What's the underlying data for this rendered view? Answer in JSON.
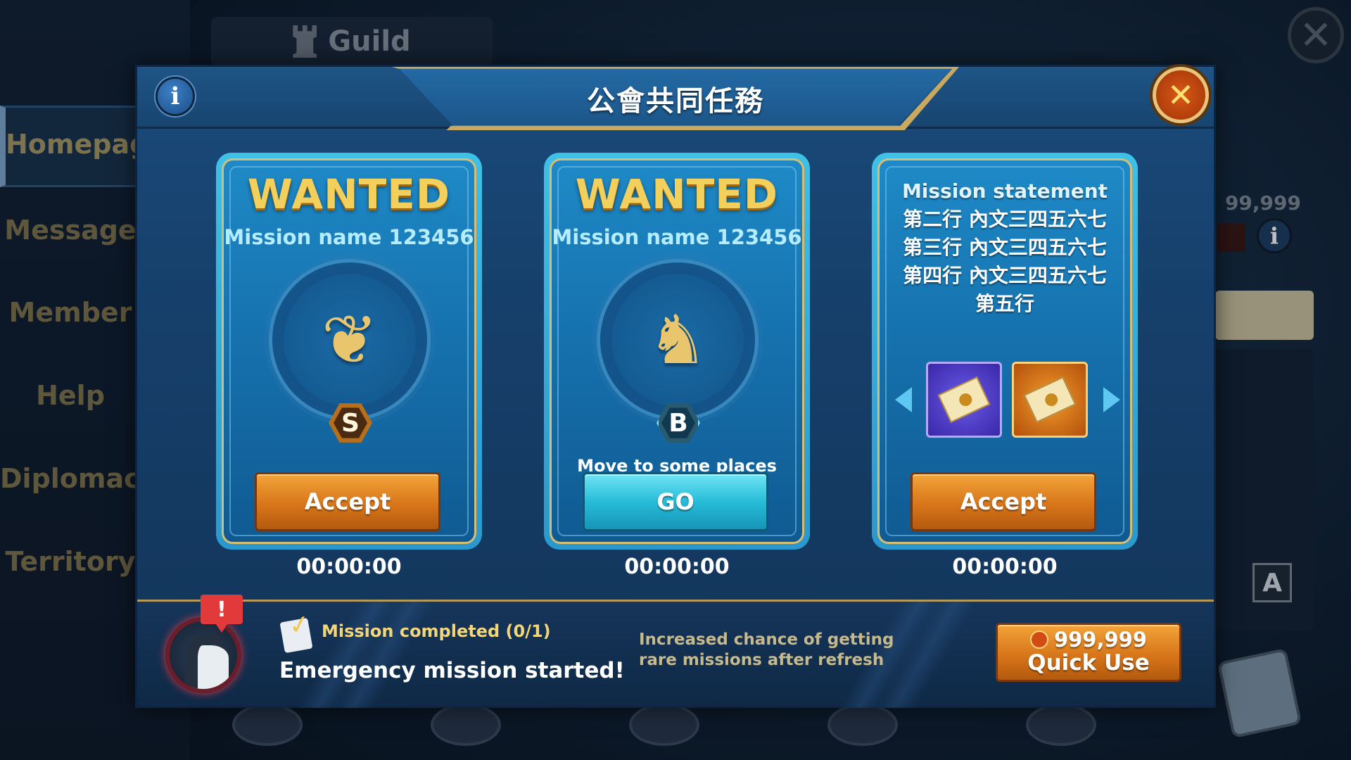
{
  "background": {
    "guild_tab": "Guild",
    "side_menu": [
      "Homepage",
      "Message",
      "Member",
      "Help",
      "Diplomacy",
      "Territory"
    ],
    "right_info": ": 99,999",
    "translate_label": "A"
  },
  "modal": {
    "title": "公會共同任務",
    "info_icon": "i",
    "close_icon": "✕",
    "cards": [
      {
        "heading": "WANTED",
        "mission_name": "Mission name 123456",
        "rank": "S",
        "button": "Accept",
        "timer": "00:00:00"
      },
      {
        "heading": "WANTED",
        "mission_name": "Mission name 123456",
        "rank": "B",
        "subtext": "Move to some places",
        "button": "GO",
        "timer": "00:00:00"
      },
      {
        "statement": [
          "Mission statement",
          "第二行 內文三四五六七",
          "第三行 內文三四五六七",
          "第四行 內文三四五六七",
          "第五行"
        ],
        "button": "Accept",
        "timer": "00:00:00"
      }
    ],
    "bottom": {
      "alert": "!",
      "mission_completed": "Mission completed (0/1)",
      "emergency": "Emergency mission started!",
      "increased": "Increased chance of getting rare missions after refresh",
      "quick_cost": "999,999",
      "quick_label": "Quick Use"
    }
  },
  "colors": {
    "gold_text": "#f3cf5c",
    "accept_orange": "#d8761a",
    "go_cyan": "#27bcd9",
    "card_blue": "#1672ae"
  }
}
